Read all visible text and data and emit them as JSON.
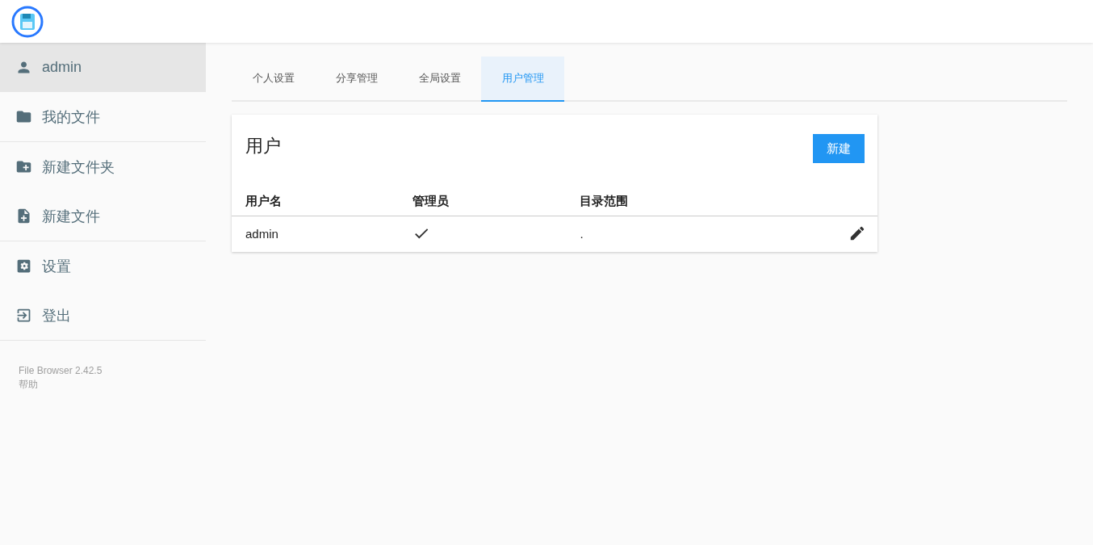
{
  "sidebar": {
    "sections": [
      [
        {
          "kind": "user",
          "label": "admin",
          "selected": true
        },
        {
          "kind": "folder",
          "label": "我的文件",
          "selected": false
        }
      ],
      [
        {
          "kind": "new-folder",
          "label": "新建文件夹",
          "selected": false
        },
        {
          "kind": "new-file",
          "label": "新建文件",
          "selected": false
        }
      ],
      [
        {
          "kind": "settings",
          "label": "设置",
          "selected": false
        },
        {
          "kind": "logout",
          "label": "登出",
          "selected": false
        }
      ]
    ],
    "footer": {
      "version": "File Browser 2.42.5",
      "help": "帮助"
    }
  },
  "tabs": [
    {
      "label": "个人设置",
      "selected": false
    },
    {
      "label": "分享管理",
      "selected": false
    },
    {
      "label": "全局设置",
      "selected": false
    },
    {
      "label": "用户管理",
      "selected": true
    }
  ],
  "card": {
    "title": "用户",
    "new_button": "新建",
    "table": {
      "columns": [
        "用户名",
        "管理员",
        "目录范围"
      ],
      "rows": [
        {
          "username": "admin",
          "admin": true,
          "scope": "."
        }
      ]
    }
  }
}
